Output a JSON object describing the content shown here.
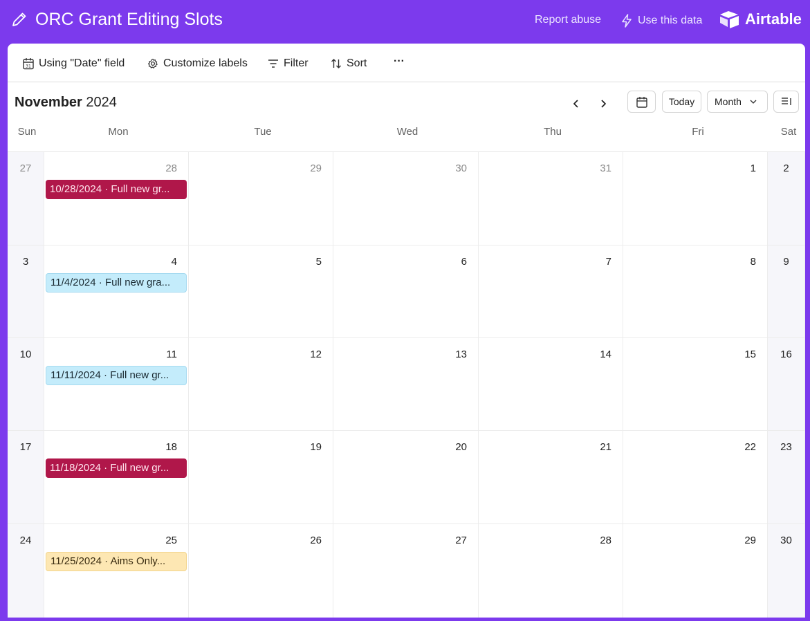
{
  "header": {
    "title": "ORC Grant Editing Slots",
    "report_label": "Report abuse",
    "use_data_label": "Use this data",
    "brand": "Airtable",
    "pencil_icon": "pencil-icon",
    "bolt_icon": "lightning-icon",
    "logo_icon": "airtable-logo"
  },
  "toolbar": {
    "date_field_label": "Using \"Date\" field",
    "customize_label": "Customize labels",
    "filter_label": "Filter",
    "sort_label": "Sort",
    "more_label": "···"
  },
  "calendar": {
    "month_bold": "November",
    "year": "2024",
    "today_label": "Today",
    "view_label": "Month",
    "weekdays": [
      "Sun",
      "Mon",
      "Tue",
      "Wed",
      "Thu",
      "Fri",
      "Sat"
    ],
    "weeks": [
      {
        "days": [
          {
            "num": "27",
            "other": true
          },
          {
            "num": "28",
            "other": true
          },
          {
            "num": "29",
            "other": true
          },
          {
            "num": "30",
            "other": true
          },
          {
            "num": "31",
            "other": true
          },
          {
            "num": "1"
          },
          {
            "num": "2"
          }
        ]
      },
      {
        "days": [
          {
            "num": "3"
          },
          {
            "num": "4"
          },
          {
            "num": "5"
          },
          {
            "num": "6"
          },
          {
            "num": "7"
          },
          {
            "num": "8"
          },
          {
            "num": "9"
          }
        ]
      },
      {
        "days": [
          {
            "num": "10"
          },
          {
            "num": "11"
          },
          {
            "num": "12"
          },
          {
            "num": "13"
          },
          {
            "num": "14"
          },
          {
            "num": "15"
          },
          {
            "num": "16"
          }
        ]
      },
      {
        "days": [
          {
            "num": "17"
          },
          {
            "num": "18"
          },
          {
            "num": "19"
          },
          {
            "num": "20"
          },
          {
            "num": "21"
          },
          {
            "num": "22"
          },
          {
            "num": "23"
          }
        ]
      },
      {
        "days": [
          {
            "num": "24"
          },
          {
            "num": "25"
          },
          {
            "num": "26"
          },
          {
            "num": "27"
          },
          {
            "num": "28"
          },
          {
            "num": "29"
          },
          {
            "num": "30"
          }
        ]
      }
    ],
    "events": [
      {
        "week": 0,
        "day": 1,
        "label": "10/28/2024 · Full new gr...",
        "color": "red"
      },
      {
        "week": 1,
        "day": 1,
        "label": "11/4/2024 · Full new gra...",
        "color": "blue"
      },
      {
        "week": 2,
        "day": 1,
        "label": "11/11/2024 · Full new gr...",
        "color": "blue"
      },
      {
        "week": 3,
        "day": 1,
        "label": "11/18/2024 · Full new gr...",
        "color": "red"
      },
      {
        "week": 4,
        "day": 1,
        "label": "11/25/2024 · Aims Only...",
        "color": "yellow"
      }
    ]
  },
  "colors": {
    "brand_purple": "#7c3aed",
    "event_red": "#b0174a",
    "event_blue": "#c4ecfb",
    "event_yellow": "#fde7b3"
  }
}
